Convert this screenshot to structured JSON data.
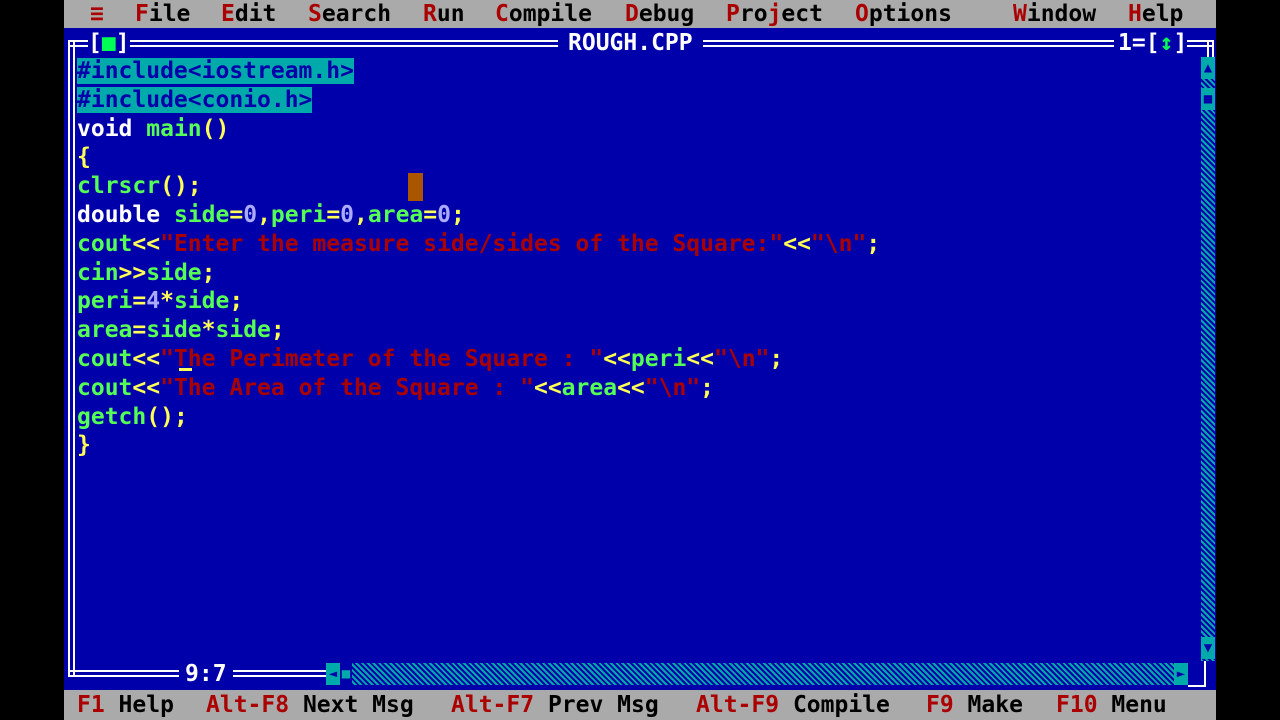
{
  "menu": {
    "system_icon": "≡",
    "items": [
      {
        "hot": "F",
        "rest": "ile"
      },
      {
        "hot": "E",
        "rest": "dit"
      },
      {
        "hot": "S",
        "rest": "earch"
      },
      {
        "hot": "R",
        "rest": "un"
      },
      {
        "hot": "C",
        "rest": "ompile"
      },
      {
        "hot": "D",
        "rest": "ebug"
      },
      {
        "pre": "Pro",
        "hot": "j",
        "rest": "ect"
      },
      {
        "hot": "O",
        "rest": "ptions"
      },
      {
        "hot": "W",
        "rest": "indow"
      },
      {
        "hot": "H",
        "rest": "elp"
      }
    ]
  },
  "window": {
    "title": "ROUGH.CPP",
    "close_open": "[",
    "close_glyph": "■",
    "close_close": "]",
    "number": "1",
    "zoom_open": "[",
    "zoom_glyph": "↕",
    "zoom_close": "]",
    "cursor_position": "9:7"
  },
  "code": [
    [
      {
        "t": "#include<iostream.h>",
        "c": "pp"
      }
    ],
    [
      {
        "t": "#include<conio.h>",
        "c": "pp"
      }
    ],
    [
      {
        "t": "void",
        "c": "kw"
      },
      {
        "t": " ",
        "c": "kw"
      },
      {
        "t": "main",
        "c": "id"
      },
      {
        "t": "()",
        "c": "sym"
      }
    ],
    [
      {
        "t": "{",
        "c": "sym"
      }
    ],
    [
      {
        "t": "clrscr",
        "c": "id"
      },
      {
        "t": "();",
        "c": "sym"
      }
    ],
    [
      {
        "t": "double",
        "c": "kw"
      },
      {
        "t": " ",
        "c": "kw"
      },
      {
        "t": "side",
        "c": "id"
      },
      {
        "t": "=",
        "c": "sym"
      },
      {
        "t": "0",
        "c": "num"
      },
      {
        "t": ",",
        "c": "sym"
      },
      {
        "t": "peri",
        "c": "id"
      },
      {
        "t": "=",
        "c": "sym"
      },
      {
        "t": "0",
        "c": "num"
      },
      {
        "t": ",",
        "c": "sym"
      },
      {
        "t": "area",
        "c": "id"
      },
      {
        "t": "=",
        "c": "sym"
      },
      {
        "t": "0",
        "c": "num"
      },
      {
        "t": ";",
        "c": "sym"
      }
    ],
    [
      {
        "t": "cout",
        "c": "id"
      },
      {
        "t": "<<",
        "c": "sym"
      },
      {
        "t": "\"Enter the measure side/sides of the Square:\"",
        "c": "str"
      },
      {
        "t": "<<",
        "c": "sym"
      },
      {
        "t": "\"\\n\"",
        "c": "str"
      },
      {
        "t": ";",
        "c": "sym"
      }
    ],
    [
      {
        "t": "cin",
        "c": "id"
      },
      {
        "t": ">>",
        "c": "sym"
      },
      {
        "t": "side",
        "c": "id"
      },
      {
        "t": ";",
        "c": "sym"
      }
    ],
    [
      {
        "t": "peri",
        "c": "id"
      },
      {
        "t": "=",
        "c": "sym"
      },
      {
        "t": "4",
        "c": "num"
      },
      {
        "t": "*",
        "c": "sym"
      },
      {
        "t": "side",
        "c": "id"
      },
      {
        "t": ";",
        "c": "sym"
      }
    ],
    [
      {
        "t": "area",
        "c": "id"
      },
      {
        "t": "=",
        "c": "sym"
      },
      {
        "t": "side",
        "c": "id"
      },
      {
        "t": "*",
        "c": "sym"
      },
      {
        "t": "side",
        "c": "id"
      },
      {
        "t": ";",
        "c": "sym"
      }
    ],
    [
      {
        "t": "cout",
        "c": "id"
      },
      {
        "t": "<<",
        "c": "sym"
      },
      {
        "t": "\"The Perimeter of the Square : \"",
        "c": "str"
      },
      {
        "t": "<<",
        "c": "sym"
      },
      {
        "t": "peri",
        "c": "id"
      },
      {
        "t": "<<",
        "c": "sym"
      },
      {
        "t": "\"\\n\"",
        "c": "str"
      },
      {
        "t": ";",
        "c": "sym"
      }
    ],
    [
      {
        "t": "cout",
        "c": "id"
      },
      {
        "t": "<<",
        "c": "sym"
      },
      {
        "t": "\"The Area of the Square : \"",
        "c": "str"
      },
      {
        "t": "<<",
        "c": "sym"
      },
      {
        "t": "area",
        "c": "id"
      },
      {
        "t": "<<",
        "c": "sym"
      },
      {
        "t": "\"\\n\"",
        "c": "str"
      },
      {
        "t": ";",
        "c": "sym"
      }
    ],
    [
      {
        "t": "getch",
        "c": "id"
      },
      {
        "t": "();",
        "c": "sym"
      }
    ],
    [
      {
        "t": "}",
        "c": "sym"
      }
    ]
  ],
  "scroll": {
    "up_arrow": "▲",
    "down_arrow": "▼",
    "left_arrow": "◄",
    "right_arrow": "►",
    "thumb": "■"
  },
  "status": {
    "keys": [
      {
        "key": "F1",
        "label": " Help"
      },
      {
        "key": "Alt-F8",
        "label": " Next Msg"
      },
      {
        "key": "Alt-F7",
        "label": " Prev Msg"
      },
      {
        "key": "Alt-F9",
        "label": " Compile"
      },
      {
        "key": "F9",
        "label": " Make"
      },
      {
        "key": "F10",
        "label": " Menu"
      }
    ]
  },
  "colors": {
    "background": "#0000aa",
    "menu": "#aaaaaa",
    "hotkey": "#aa0000",
    "identifier": "#55ff55",
    "symbol": "#ffff55",
    "number": "#aaaaff",
    "string": "#aa0000",
    "preprocessor_bg": "#00aaaa",
    "cursor": "#aa5500"
  }
}
